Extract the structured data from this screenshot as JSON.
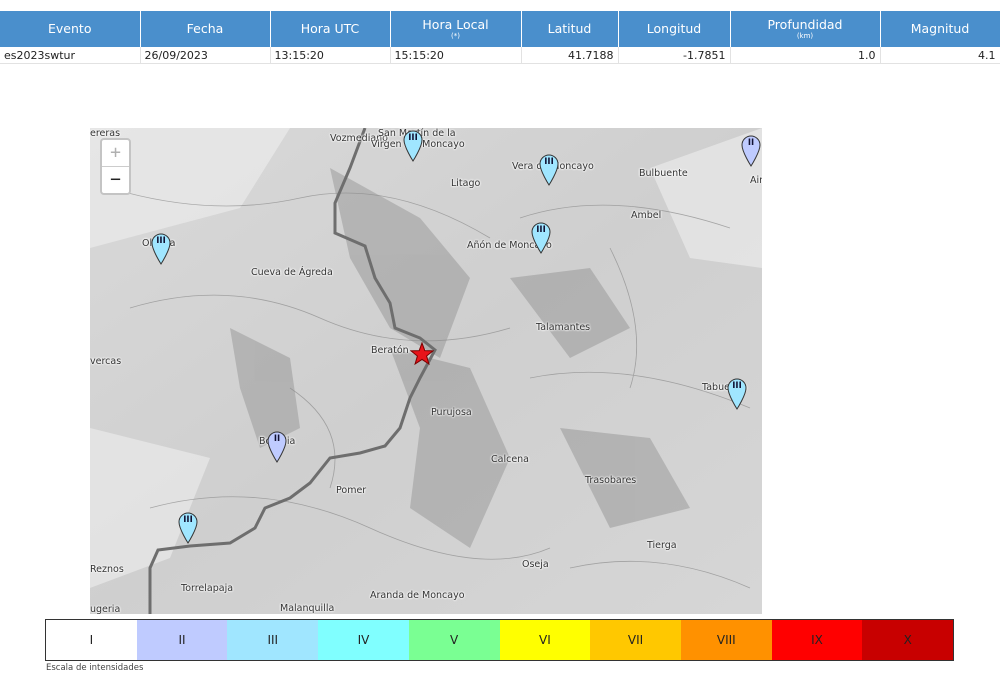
{
  "table": {
    "headers": [
      {
        "label": "Evento",
        "sub": ""
      },
      {
        "label": "Fecha",
        "sub": ""
      },
      {
        "label": "Hora UTC",
        "sub": ""
      },
      {
        "label": "Hora Local",
        "sub": "(*)"
      },
      {
        "label": "Latitud",
        "sub": ""
      },
      {
        "label": "Longitud",
        "sub": ""
      },
      {
        "label": "Profundidad",
        "sub": "(km)"
      },
      {
        "label": "Magnitud",
        "sub": ""
      }
    ],
    "row": [
      "es2023swtur",
      "26/09/2023",
      "13:15:20",
      "15:15:20",
      "41.7188",
      "-1.7851",
      "1.0",
      "4.1"
    ]
  },
  "map": {
    "zoom_in": "+",
    "zoom_out": "−",
    "places": [
      "Vozmediano",
      "San Martín de la",
      "Virgen del Moncayo",
      "Vera de Moncayo",
      "Bulbuente",
      "Litago",
      "Ambel",
      "Olvega",
      "Cueva de Ágreda",
      "Añón de Moncayo",
      "Talamantes",
      "Beratón",
      "Purujosa",
      "Borobia",
      "Calcena",
      "Trasobares",
      "Pomer",
      "Tierga",
      "Oseja",
      "Reznos",
      "Torrelapaja",
      "Aranda de Moncayo",
      "Malanquilla",
      "Tabuenca",
      "Ain",
      "ereras",
      "vercas",
      "ugeria"
    ],
    "intensity_pins": [
      "III",
      "III",
      "II",
      "III",
      "III",
      "III",
      "II",
      "III"
    ]
  },
  "scale": {
    "caption": "Escala de intensidades",
    "levels": [
      {
        "label": "I",
        "color": "#ffffff"
      },
      {
        "label": "II",
        "color": "#bfcbff"
      },
      {
        "label": "III",
        "color": "#a0e6ff"
      },
      {
        "label": "IV",
        "color": "#80ffff"
      },
      {
        "label": "V",
        "color": "#7aff93"
      },
      {
        "label": "VI",
        "color": "#ffff00"
      },
      {
        "label": "VII",
        "color": "#ffc800"
      },
      {
        "label": "VIII",
        "color": "#ff9100"
      },
      {
        "label": "IX",
        "color": "#ff0000"
      },
      {
        "label": "X",
        "color": "#c80000"
      }
    ]
  }
}
